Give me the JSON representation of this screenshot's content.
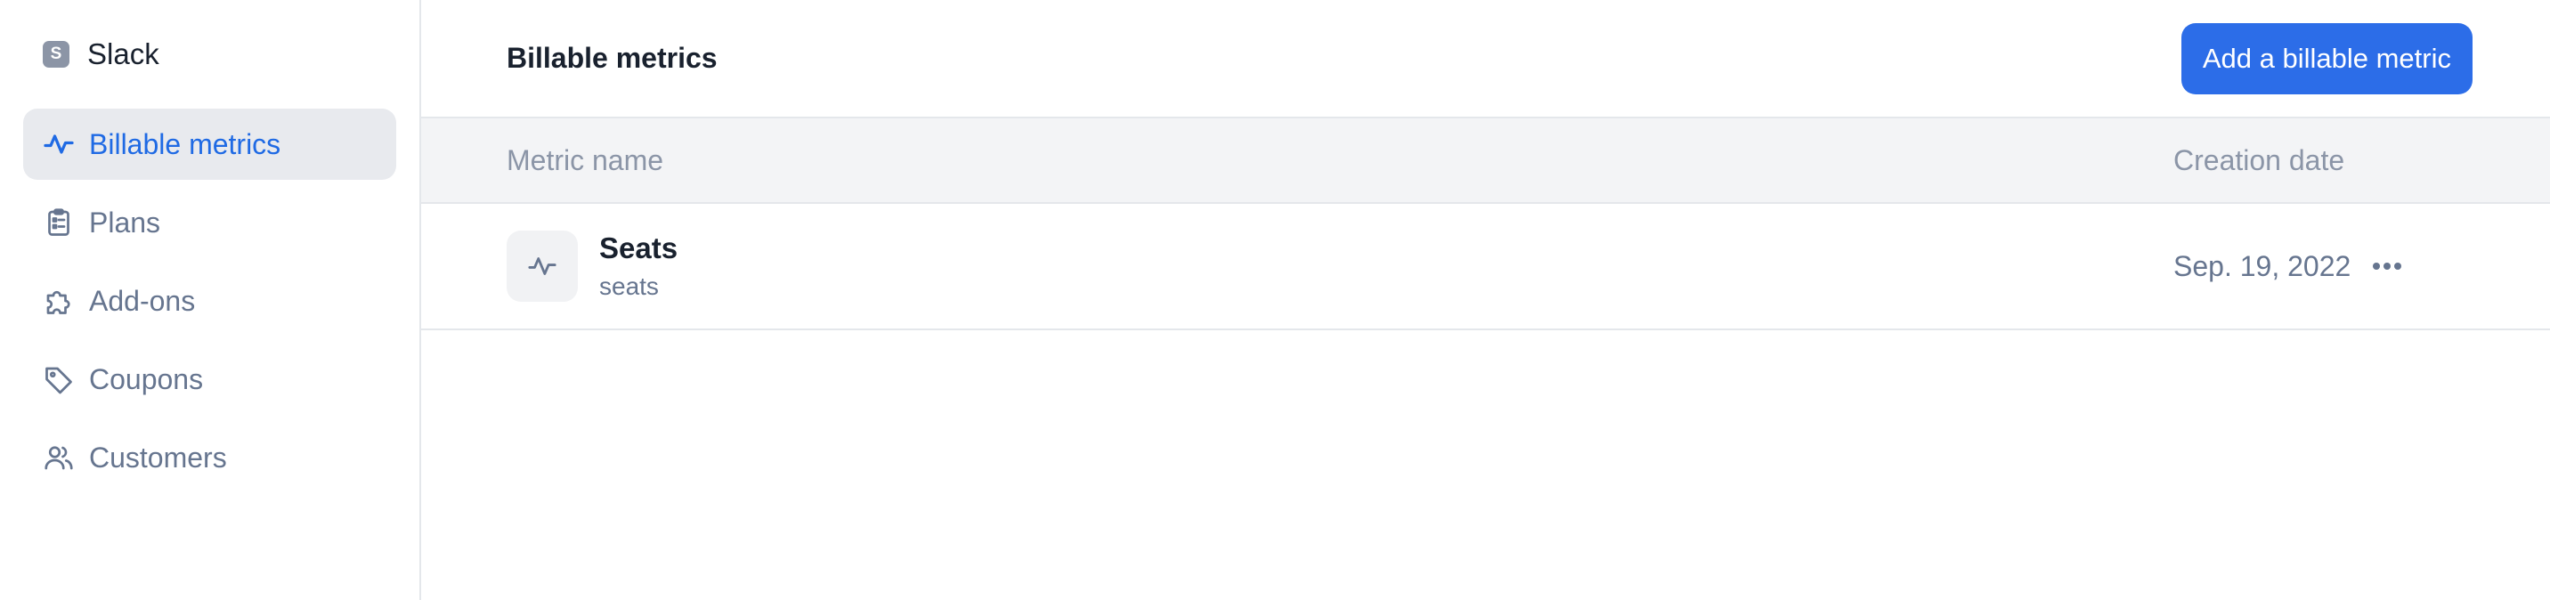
{
  "org": {
    "badge": "S",
    "name": "Slack"
  },
  "sidebar": {
    "items": [
      {
        "label": "Billable metrics",
        "icon": "pulse-icon",
        "active": true
      },
      {
        "label": "Plans",
        "icon": "clipboard-icon",
        "active": false
      },
      {
        "label": "Add-ons",
        "icon": "puzzle-icon",
        "active": false
      },
      {
        "label": "Coupons",
        "icon": "tag-icon",
        "active": false
      },
      {
        "label": "Customers",
        "icon": "users-icon",
        "active": false
      }
    ]
  },
  "header": {
    "title": "Billable metrics",
    "add_button": "Add a billable metric"
  },
  "table": {
    "columns": {
      "name": "Metric name",
      "date": "Creation date"
    },
    "rows": [
      {
        "name": "Seats",
        "code": "seats",
        "created": "Sep. 19, 2022",
        "icon": "pulse-icon"
      }
    ]
  },
  "colors": {
    "accent": "#2c6de8",
    "active_text": "#1f6ae4",
    "active_bg": "#e8eaee",
    "muted_text": "#66758f",
    "border": "#e4e7eb",
    "header_bg": "#f3f4f6"
  }
}
